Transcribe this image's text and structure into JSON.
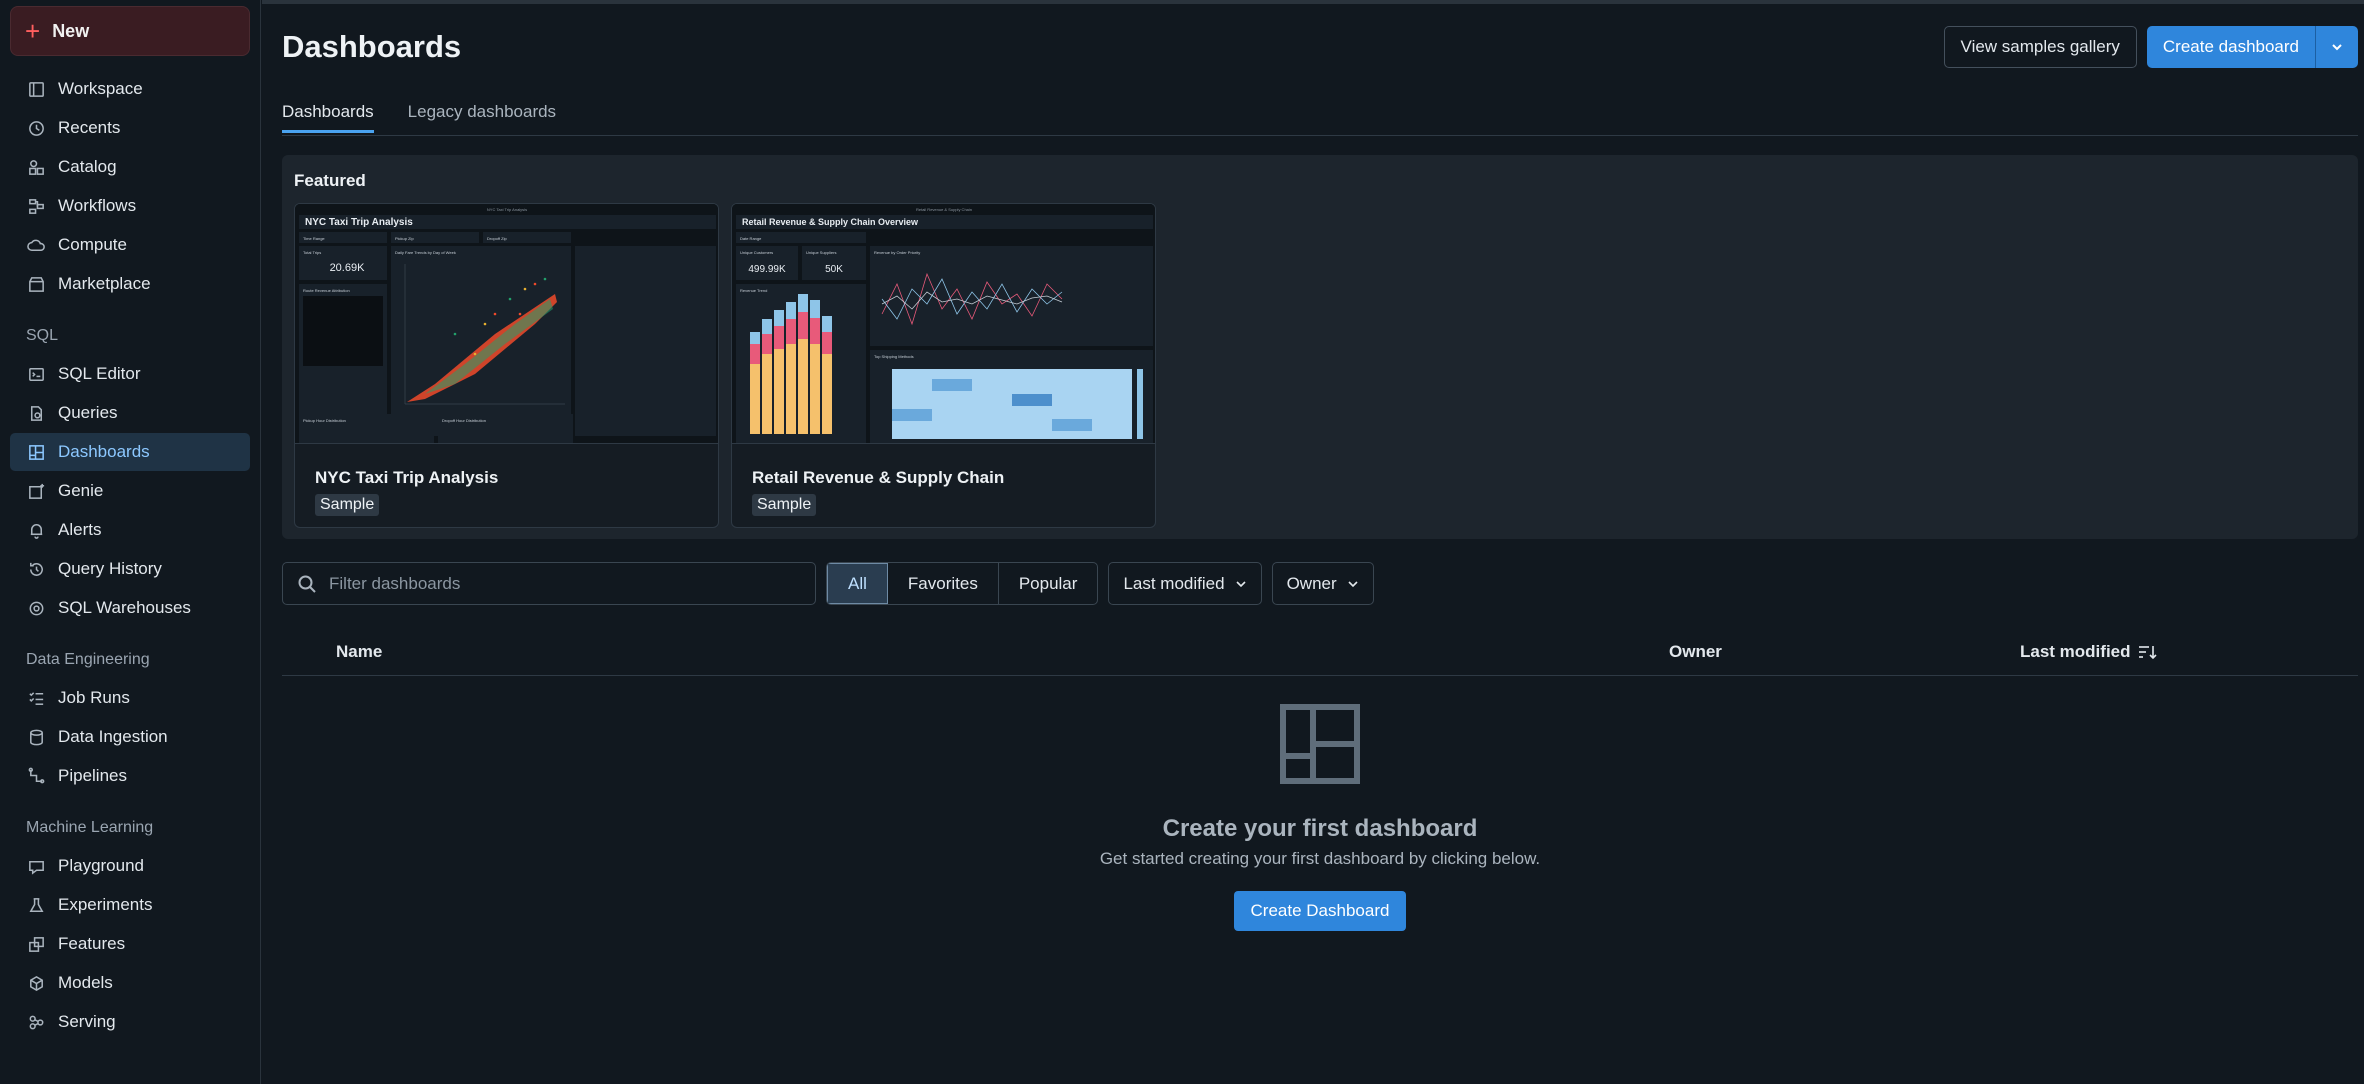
{
  "sidebar": {
    "new_label": "New",
    "items_top": [
      {
        "label": "Workspace",
        "icon": "workspace-icon"
      },
      {
        "label": "Recents",
        "icon": "clock-icon"
      },
      {
        "label": "Catalog",
        "icon": "catalog-icon"
      },
      {
        "label": "Workflows",
        "icon": "workflows-icon"
      },
      {
        "label": "Compute",
        "icon": "cloud-icon"
      },
      {
        "label": "Marketplace",
        "icon": "store-icon"
      }
    ],
    "sql_label": "SQL",
    "items_sql": [
      {
        "label": "SQL Editor",
        "icon": "sql-editor-icon"
      },
      {
        "label": "Queries",
        "icon": "query-icon"
      },
      {
        "label": "Dashboards",
        "icon": "dashboard-icon",
        "active": true
      },
      {
        "label": "Genie",
        "icon": "genie-icon"
      },
      {
        "label": "Alerts",
        "icon": "bell-icon"
      },
      {
        "label": "Query History",
        "icon": "history-icon"
      },
      {
        "label": "SQL Warehouses",
        "icon": "warehouse-icon"
      }
    ],
    "de_label": "Data Engineering",
    "items_de": [
      {
        "label": "Job Runs",
        "icon": "job-runs-icon"
      },
      {
        "label": "Data Ingestion",
        "icon": "ingestion-icon"
      },
      {
        "label": "Pipelines",
        "icon": "pipeline-icon"
      }
    ],
    "ml_label": "Machine Learning",
    "items_ml": [
      {
        "label": "Playground",
        "icon": "playground-icon"
      },
      {
        "label": "Experiments",
        "icon": "flask-icon"
      },
      {
        "label": "Features",
        "icon": "features-icon"
      },
      {
        "label": "Models",
        "icon": "models-icon"
      },
      {
        "label": "Serving",
        "icon": "serving-icon"
      }
    ]
  },
  "header": {
    "title": "Dashboards",
    "view_samples": "View samples gallery",
    "create_dashboard": "Create dashboard"
  },
  "tabs": [
    "Dashboards",
    "Legacy dashboards"
  ],
  "featured": {
    "title": "Featured",
    "cards": [
      {
        "name": "NYC Taxi Trip Analysis",
        "badge": "Sample",
        "thumb_title": "NYC Taxi Trip Analysis",
        "thumb_header": "NYC Taxi Trip Analysis",
        "filters": [
          "Time Range",
          "Pickup Zip",
          "Dropoff Zip"
        ],
        "kpi_label": "Total Trips",
        "kpi_value": "20.69K",
        "chart_title": "Daily Fare Trends by Day of Week",
        "table_title": "Route Revenue Attribution",
        "bottom_left": "Pickup Hour Distribution",
        "bottom_right": "Dropoff Hour Distribution"
      },
      {
        "name": "Retail Revenue & Supply Chain",
        "badge": "Sample",
        "thumb_title": "Retail Revenue & Supply Chain Overview",
        "thumb_header": "Retail Revenue & Supply Chain",
        "filters": [
          "Date Range"
        ],
        "kpi1_label": "Unique Customers",
        "kpi1_value": "499.99K",
        "kpi2_label": "Unique Suppliers",
        "kpi2_value": "50K",
        "chart_title": "Revenue by Order Priority",
        "bar_title": "Revenue Trend",
        "heat_title": "Top Shipping Methods"
      }
    ]
  },
  "filters": {
    "search_placeholder": "Filter dashboards",
    "segments": [
      "All",
      "Favorites",
      "Popular"
    ],
    "active_segment": "All",
    "last_modified": "Last modified",
    "owner": "Owner"
  },
  "table": {
    "col_name": "Name",
    "col_owner": "Owner",
    "col_modified": "Last modified"
  },
  "empty": {
    "title": "Create your first dashboard",
    "subtitle": "Get started creating your first dashboard by clicking below.",
    "button": "Create Dashboard"
  },
  "colors": {
    "accent": "#2f86dc",
    "active_nav_bg": "#1f3345",
    "new_button_bg": "#3a1c22"
  }
}
